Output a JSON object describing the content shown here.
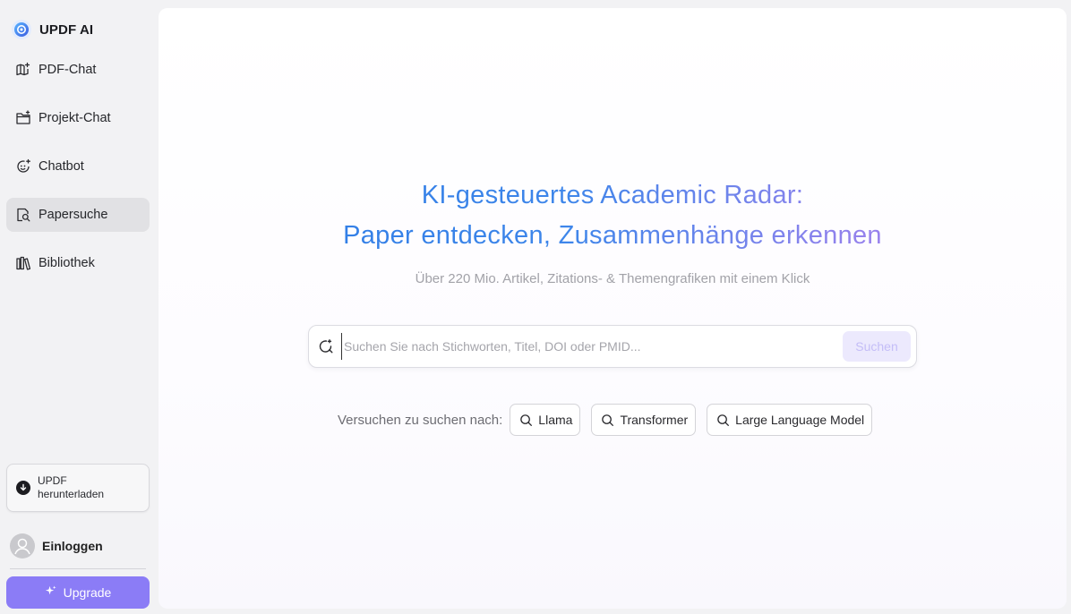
{
  "app": {
    "name": "UPDF AI"
  },
  "nav": [
    {
      "label": "PDF-Chat",
      "icon": "book-sparkle-icon",
      "active": false
    },
    {
      "label": "Projekt-Chat",
      "icon": "folder-sparkle-icon",
      "active": false
    },
    {
      "label": "Chatbot",
      "icon": "robot-face-icon",
      "active": false
    },
    {
      "label": "Papersuche",
      "icon": "document-search-icon",
      "active": true
    },
    {
      "label": "Bibliothek",
      "icon": "library-books-icon",
      "active": false
    }
  ],
  "download": {
    "line1": "UPDF",
    "line2": "herunterladen"
  },
  "account": {
    "login_label": "Einloggen"
  },
  "upgrade": {
    "label": "Upgrade"
  },
  "hero": {
    "title_line1": "KI-gesteuertes Academic Radar:",
    "title_line2": "Paper entdecken, Zusammenhänge erkennen",
    "subtitle": "Über 220 Mio. Artikel, Zitations- & Themengrafiken mit einem Klick"
  },
  "search": {
    "placeholder": "Suchen Sie nach Stichworten, Titel, DOI oder PMID...",
    "value": "",
    "button_label": "Suchen"
  },
  "suggestions": {
    "label": "Versuchen zu suchen nach:",
    "items": [
      "Llama",
      "Transformer",
      "Large Language Model"
    ]
  },
  "colors": {
    "accent": "#8b7cf6",
    "title_gradient_start": "#2a7ae4",
    "title_gradient_end": "#c07ef0",
    "active_nav_bg": "#e1e1e4"
  }
}
